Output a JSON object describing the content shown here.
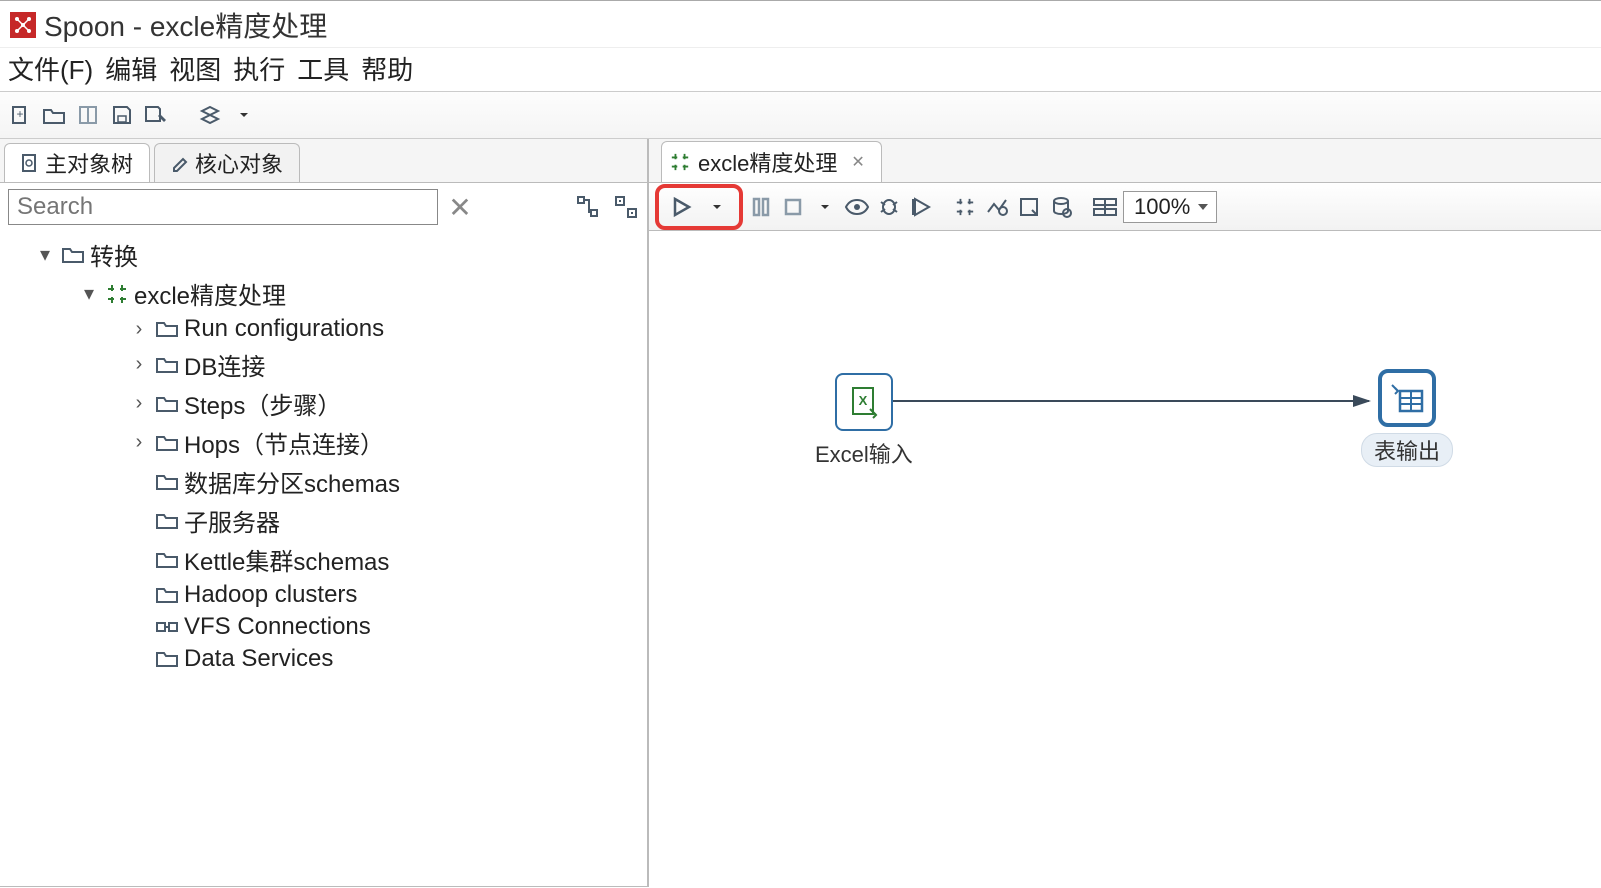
{
  "app": {
    "title": "Spoon - excle精度处理"
  },
  "menubar": [
    "文件(F)",
    "编辑",
    "视图",
    "执行",
    "工具",
    "帮助"
  ],
  "left_tabs": {
    "main_tree": "主对象树",
    "core_objects": "核心对象"
  },
  "search": {
    "placeholder": "Search"
  },
  "tree": {
    "root": "转换",
    "transformation": "excle精度处理",
    "children": [
      "Run configurations",
      "DB连接",
      "Steps（步骤）",
      "Hops（节点连接）",
      "数据库分区schemas",
      "子服务器",
      "Kettle集群schemas",
      "Hadoop clusters",
      "VFS Connections",
      "Data Services"
    ]
  },
  "canvas_tab": "excle精度处理",
  "zoom": "100%",
  "steps": {
    "excel_input": "Excel输入",
    "table_output": "表输出"
  }
}
